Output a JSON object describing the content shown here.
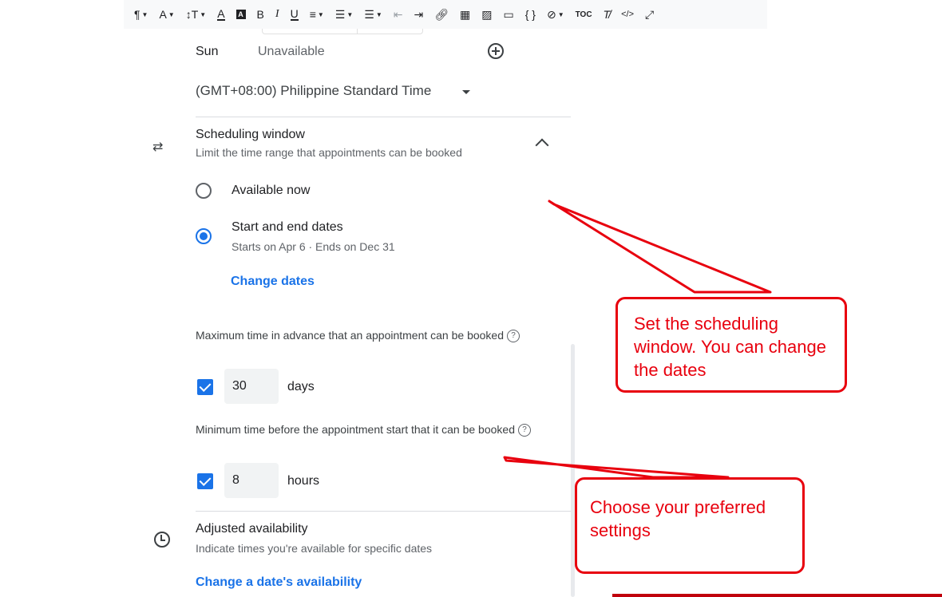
{
  "toolbar": {
    "items": [
      "paragraph-icon",
      "font-color-icon",
      "text-size-icon",
      "underline-color-icon",
      "highlight-icon",
      "bold-icon",
      "italic-icon",
      "underline-icon",
      "align-icon",
      "ordered-list-icon",
      "unordered-list-icon",
      "indent-decrease-icon",
      "indent-increase-icon",
      "link-icon",
      "table-icon",
      "image-icon",
      "video-icon",
      "code-icon",
      "attachment-icon",
      "toc-icon",
      "clear-format-icon",
      "html-icon",
      "expand-icon"
    ],
    "labels": {
      "bold": "B",
      "italic": "I",
      "underline": "U",
      "toc": "TOC",
      "code": "{ }",
      "html": "</>"
    }
  },
  "availability": {
    "day": "Sun",
    "status": "Unavailable",
    "timezone": "(GMT+08:00) Philippine Standard Time"
  },
  "scheduling_window": {
    "title": "Scheduling window",
    "subtitle": "Limit the time range that appointments can be booked",
    "option_now": "Available now",
    "option_dates": "Start and end dates",
    "dates_summary": "Starts on Apr 6 · Ends on Dec 31",
    "change_dates": "Change dates",
    "selected": "Start and end dates"
  },
  "max_advance": {
    "label": "Maximum time in advance that an appointment can be booked",
    "checked": true,
    "value": "30",
    "unit": "days"
  },
  "min_before": {
    "label": "Minimum time before the appointment start that it can be booked",
    "checked": true,
    "value": "8",
    "unit": "hours"
  },
  "adjusted": {
    "title": "Adjusted availability",
    "subtitle": "Indicate times you're available for specific dates",
    "link": "Change a date's availability"
  },
  "annotations": {
    "callout1": "Set the scheduling window. You can change the dates",
    "callout2": "Choose your preferred settings",
    "color": "#e8000e"
  },
  "colors": {
    "accent": "#1a73e8",
    "annotation": "#e8000e"
  }
}
